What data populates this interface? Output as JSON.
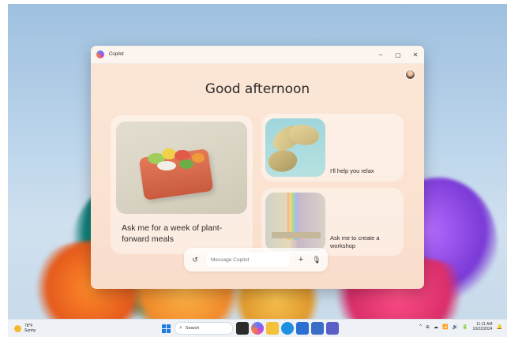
{
  "window": {
    "app_title": "Copilot",
    "controls": {
      "minimize": "–",
      "maximize": "▢",
      "close": "✕"
    }
  },
  "greeting": "Good afternoon",
  "cards": [
    {
      "id": "plant-forward",
      "text": "Ask me for a week of plant-forward meals",
      "image_icon": "food-box-illustration"
    },
    {
      "id": "relax",
      "text": "I'll help you relax",
      "image_icon": "leaves-illustration"
    },
    {
      "id": "workshop",
      "text": "Ask me to create a workshop",
      "image_icon": "workshop-illustration"
    }
  ],
  "compose": {
    "placeholder": "Message Copilot",
    "history_icon": "↺",
    "add_icon": "+",
    "mic_icon": "🎙"
  },
  "taskbar": {
    "weather": {
      "temp": "78°F",
      "condition": "Sunny"
    },
    "search_label": "Search",
    "clock": {
      "time": "11:11 AM",
      "date": "10/22/2024"
    },
    "tray_icons": [
      "^",
      "⊕",
      "☁",
      "📶",
      "🔊",
      "🔋",
      "🔔"
    ]
  }
}
